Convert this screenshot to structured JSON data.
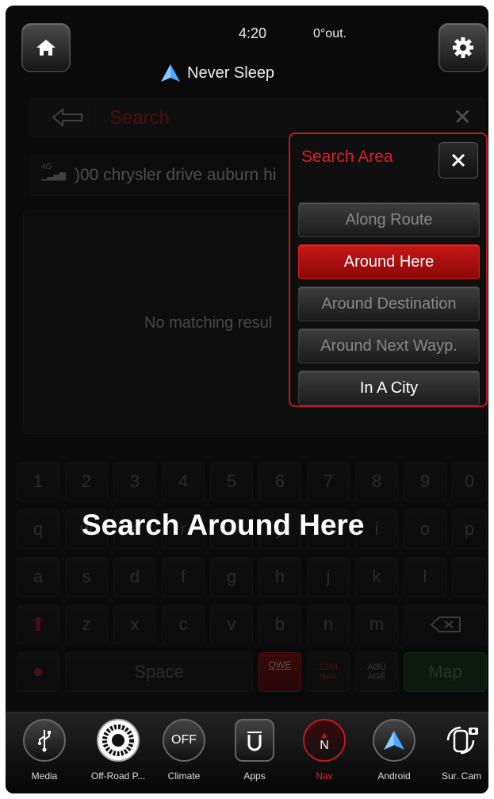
{
  "status": {
    "time": "4:20",
    "temperature": "0°out."
  },
  "header": {
    "app_title": "Never Sleep"
  },
  "search": {
    "placeholder": "Search"
  },
  "location": {
    "network": "4G",
    "address": ")00 chrysler drive auburn hi"
  },
  "results": {
    "message": "No matching resul"
  },
  "keyboard": {
    "numbers": [
      "1",
      "2",
      "3",
      "4",
      "5",
      "6",
      "7",
      "8",
      "9",
      "0"
    ],
    "row1": [
      "q",
      "w",
      "e",
      "r",
      "t",
      "y",
      "u",
      "i",
      "o",
      "p"
    ],
    "row2": [
      "a",
      "s",
      "d",
      "f",
      "g",
      "h",
      "j",
      "k",
      "l"
    ],
    "row3": [
      "z",
      "x",
      "c",
      "v",
      "b",
      "n",
      "m"
    ],
    "space": "Space",
    "qwe": "QWE",
    "symbols_line1": "1234",
    "symbols_line2": "!$#&",
    "intl_line1": "AØÜ",
    "intl_line2": "ÁGĖ",
    "map": "Map"
  },
  "overlay_label": "Search Around Here",
  "search_area": {
    "title": "Search Area",
    "options": [
      "Along Route",
      "Around Here",
      "Around Destination",
      "Around Next Wayp.",
      "In A City"
    ],
    "selected": "Around Here"
  },
  "nav": [
    {
      "label": "Media",
      "icon": "usb-icon"
    },
    {
      "label": "Off-Road P...",
      "icon": "tire-icon"
    },
    {
      "label": "Climate",
      "icon": "climate-off-icon",
      "icon_text": "OFF"
    },
    {
      "label": "Apps",
      "icon": "apps-icon"
    },
    {
      "label": "Nav",
      "icon": "compass-icon",
      "icon_text": "N",
      "active": true
    },
    {
      "label": "Android",
      "icon": "android-auto-icon"
    },
    {
      "label": "Sur. Cam",
      "icon": "surround-camera-icon"
    }
  ],
  "colors": {
    "accent": "#c01820",
    "background": "#0a0a0a",
    "selected_bg": "#b00c0c"
  }
}
